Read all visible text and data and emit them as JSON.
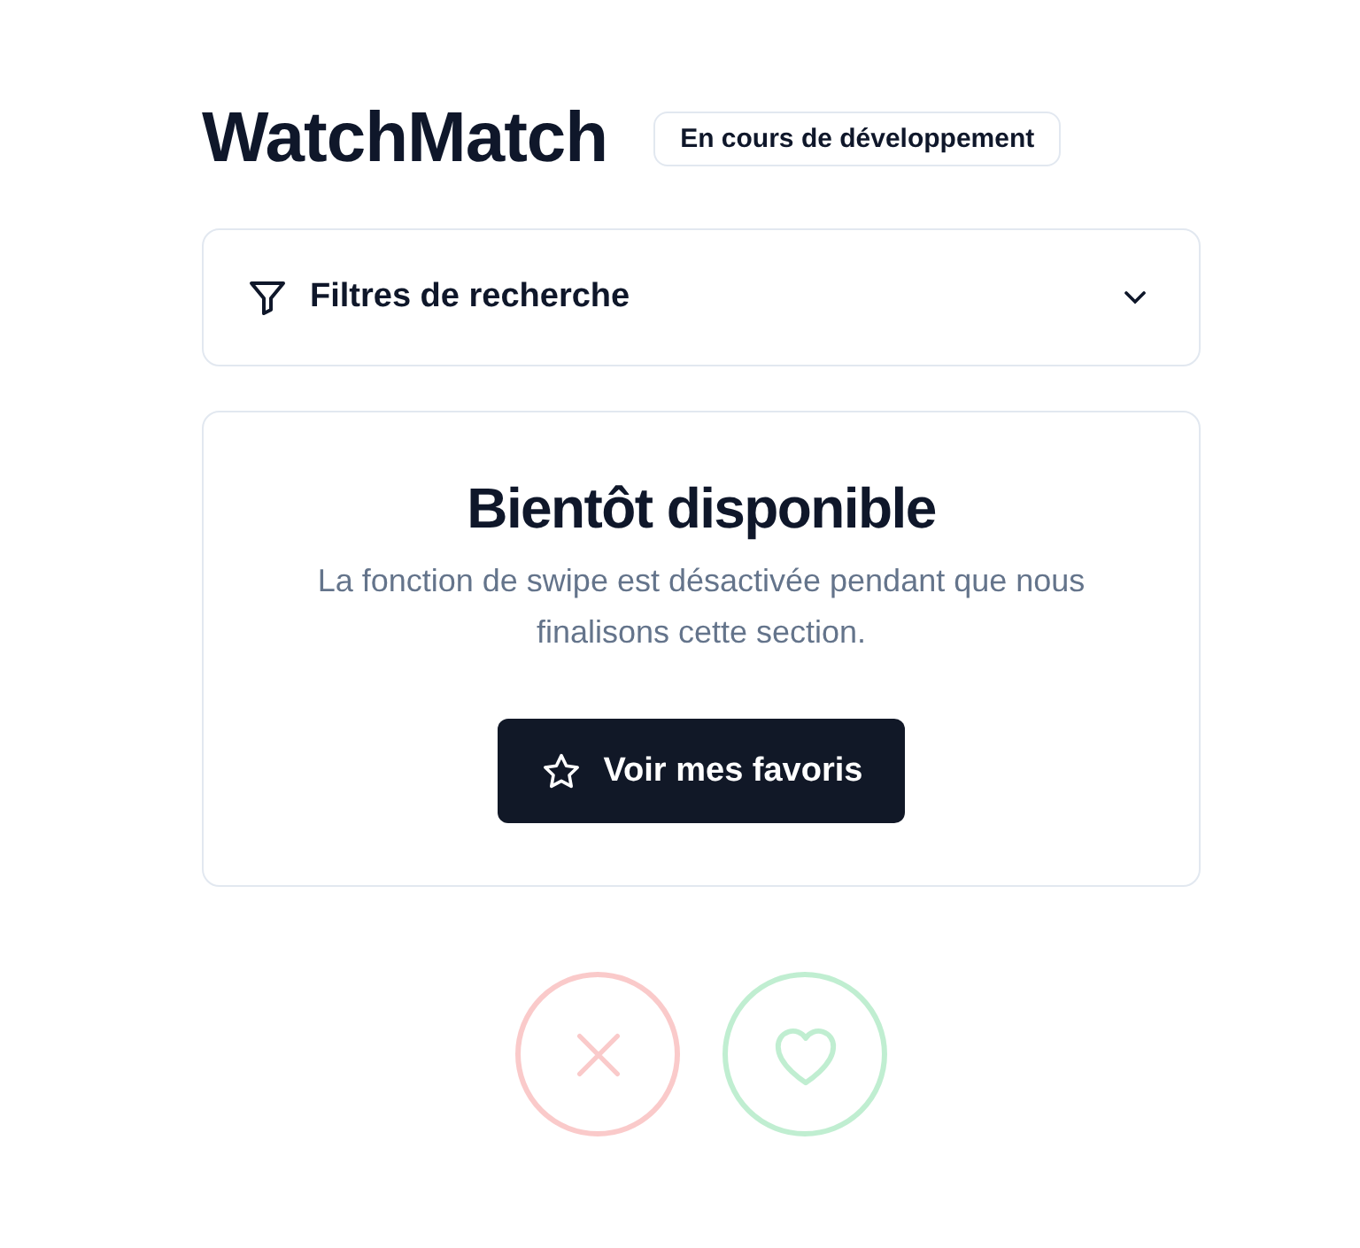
{
  "header": {
    "title": "WatchMatch",
    "badge": "En cours de développement"
  },
  "filters": {
    "label": "Filtres de recherche",
    "expanded": false
  },
  "notice": {
    "title": "Bientôt disponible",
    "message": "La fonction de swipe est désactivée pendant que nous finalisons cette section.",
    "button": "Voir mes favoris"
  },
  "actions": [
    {
      "kind": "dislike",
      "disabled": true
    },
    {
      "kind": "like",
      "disabled": true
    }
  ]
}
